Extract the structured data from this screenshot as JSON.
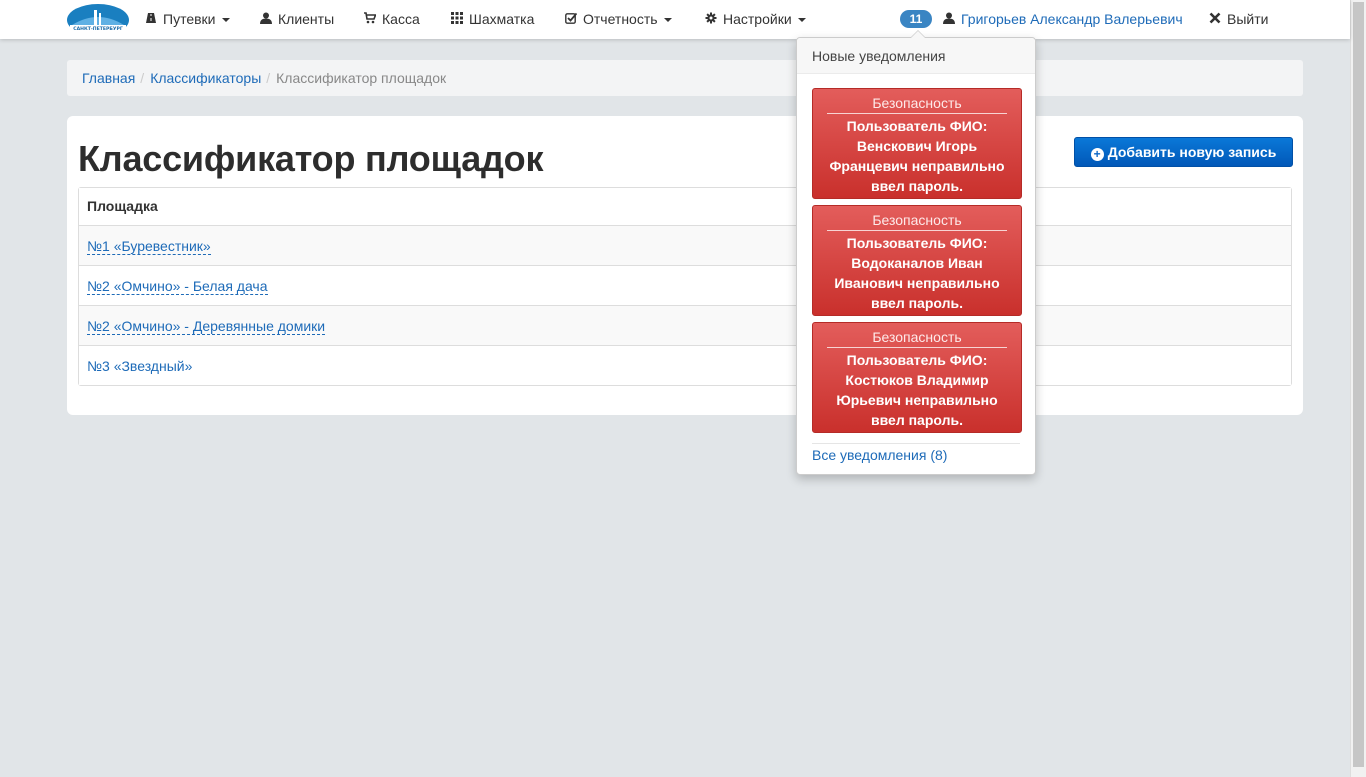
{
  "navbar": {
    "logo_text": "ВОДОКАНАЛ САНКТ-ПЕТЕРБУРГА",
    "items": [
      {
        "label": "Путевки",
        "icon": "road-icon",
        "dropdown": true
      },
      {
        "label": "Клиенты",
        "icon": "user-icon",
        "dropdown": false
      },
      {
        "label": "Касса",
        "icon": "cart-icon",
        "dropdown": false
      },
      {
        "label": "Шахматка",
        "icon": "grid-icon",
        "dropdown": false
      },
      {
        "label": "Отчетность",
        "icon": "check-icon",
        "dropdown": true
      },
      {
        "label": "Настройки",
        "icon": "gear-icon",
        "dropdown": true
      }
    ],
    "notification_count": "11",
    "user_name": "Григорьев Александр Валерьевич",
    "logout_label": "Выйти"
  },
  "breadcrumb": {
    "items": [
      "Главная",
      "Классификаторы"
    ],
    "active": "Классификатор площадок"
  },
  "page": {
    "title": "Классификатор площадок",
    "add_button": "Добавить новую запись"
  },
  "table": {
    "header": "Площадка",
    "rows": [
      "№1 «Буревестник»",
      "№2 «Омчино» - Белая дача",
      "№2 «Омчино» - Деревянные домики",
      "№3 «Звездный»"
    ]
  },
  "notifications": {
    "title": "Новые уведомления",
    "items": [
      {
        "category": "Безопасность",
        "message": "Пользователь ФИО: Венскович Игорь Францевич неправильно ввел пароль."
      },
      {
        "category": "Безопасность",
        "message": "Пользователь ФИО: Водоканалов Иван Иванович неправильно ввел пароль."
      },
      {
        "category": "Безопасность",
        "message": "Пользователь ФИО: Костюков Владимир Юрьевич неправильно ввел пароль."
      }
    ],
    "all_link": "Все уведомления (8)"
  },
  "colors": {
    "link": "#1e6bb8",
    "danger": "#d9534f",
    "primary": "#0a65c6",
    "badge": "#3a85c3",
    "background": "#e1e5e8"
  }
}
